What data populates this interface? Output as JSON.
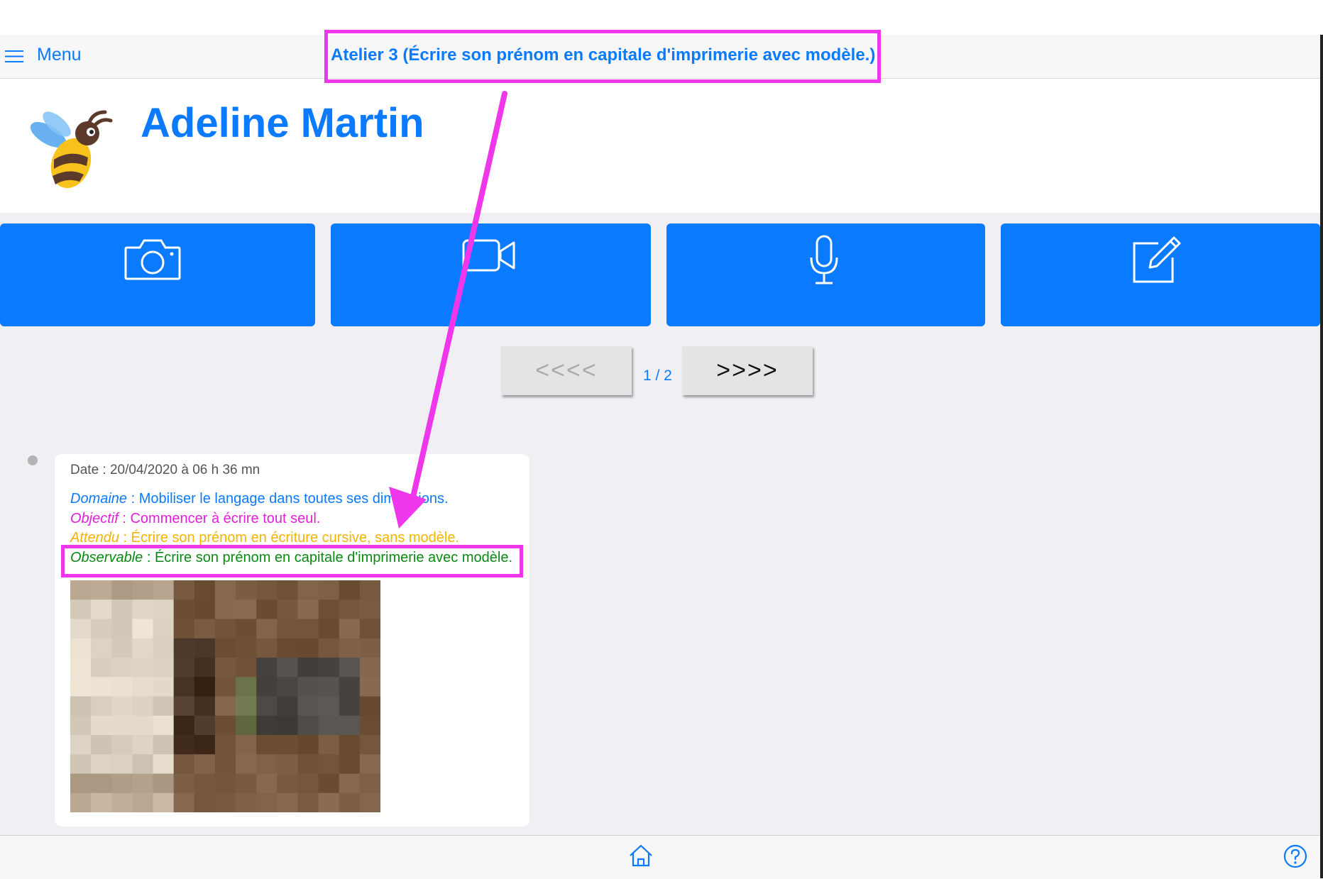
{
  "header": {
    "menu_label": "Menu",
    "atelier_title": "Atelier 3 (Écrire son prénom en capitale d'imprimerie avec modèle.)"
  },
  "student": {
    "name": "Adeline Martin",
    "avatar_icon": "bee-icon"
  },
  "actions": [
    {
      "icon": "camera-icon"
    },
    {
      "icon": "video-camera-icon"
    },
    {
      "icon": "microphone-icon"
    },
    {
      "icon": "edit-note-icon"
    }
  ],
  "pager": {
    "prev_label": "<<<<",
    "next_label": ">>>>",
    "count": "1 / 2"
  },
  "observation": {
    "date": "Date : 20/04/2020 à 06 h 36 mn",
    "domaine_key": "Domaine",
    "domaine_value": " : Mobiliser le langage dans toutes ses dimensions.",
    "objectif_key": "Objectif",
    "objectif_value": " : Commencer à écrire tout seul.",
    "attendu_key": "Attendu",
    "attendu_value": " : Écrire son prénom en écriture cursive, sans modèle.",
    "observable_key": "Observable",
    "observable_value": " : Écrire son prénom en capitale d'imprimerie avec modèle.",
    "photo": "pixelated-photo"
  },
  "footer": {
    "home_icon": "home-icon",
    "help_icon": "help-icon"
  },
  "colors": {
    "accent": "#0a7aff",
    "objectif": "#e21fd9",
    "attendu": "#f4b400",
    "observable": "#0a8a13",
    "annotation": "#ee36ea"
  }
}
